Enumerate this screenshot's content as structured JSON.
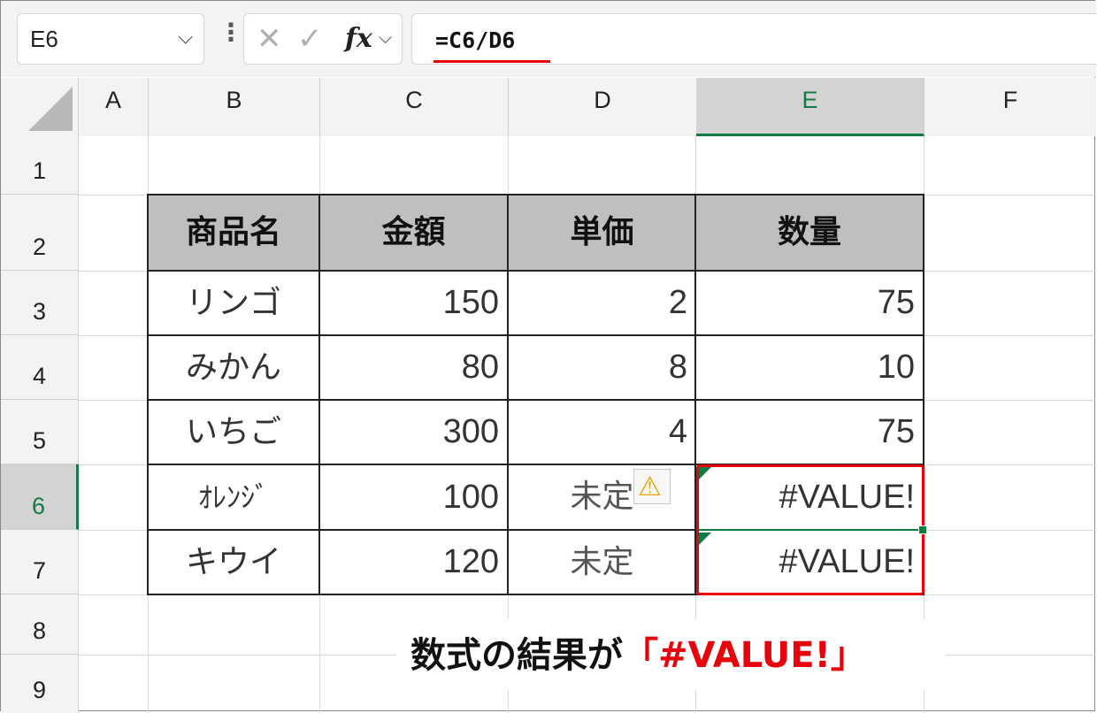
{
  "name_box": {
    "value": "E6"
  },
  "formula_bar": {
    "cancel_icon": "✕",
    "enter_icon": "✓",
    "fx_label": "fx",
    "formula": "=C6/D6"
  },
  "columns": [
    "A",
    "B",
    "C",
    "D",
    "E",
    "F"
  ],
  "rows": [
    "1",
    "2",
    "3",
    "4",
    "5",
    "6",
    "7",
    "8",
    "9"
  ],
  "selected_column": "E",
  "selected_row": "6",
  "table": {
    "headers": [
      "商品名",
      "金額",
      "単価",
      "数量"
    ],
    "rows": [
      [
        "リンゴ",
        "150",
        "2",
        "75"
      ],
      [
        "みかん",
        "80",
        "8",
        "10"
      ],
      [
        "いちご",
        "300",
        "4",
        "75"
      ],
      [
        "ｵﾚﾝｼﾞ",
        "100",
        "未定",
        "#VALUE!"
      ],
      [
        "キウイ",
        "120",
        "未定",
        "#VALUE!"
      ]
    ]
  },
  "caption": {
    "prefix": "数式の結果が",
    "highlight": "「#VALUE!」"
  },
  "colors": {
    "header_fill": "#bfbfbf",
    "selection": "#107c41",
    "highlight": "#e8000b"
  }
}
